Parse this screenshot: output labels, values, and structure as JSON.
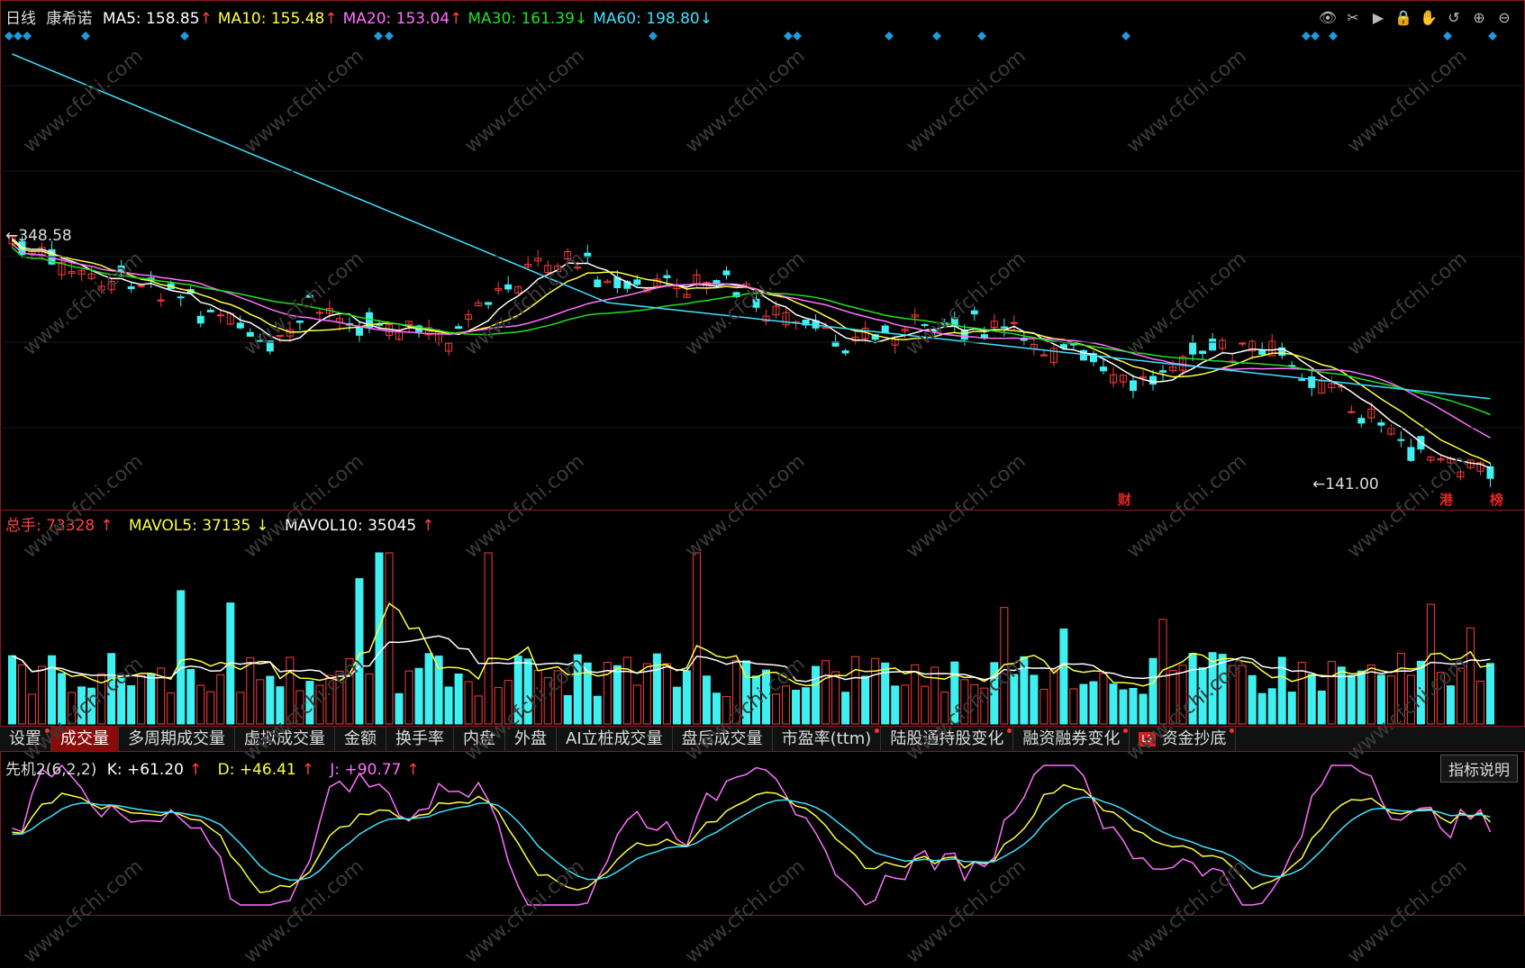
{
  "main": {
    "period": "日线",
    "stock_name": "康希诺",
    "ma": [
      {
        "label": "MA5: 158.85",
        "arrow": "↑",
        "color": "#ffffff"
      },
      {
        "label": "MA10: 155.48",
        "arrow": "↑",
        "color": "#ffff40"
      },
      {
        "label": "MA20: 153.04",
        "arrow": "↑",
        "color": "#ff70ff"
      },
      {
        "label": "MA30: 161.39",
        "arrow": "↓",
        "color": "#20e020"
      },
      {
        "label": "MA60: 198.80",
        "arrow": "↓",
        "color": "#40e0ff"
      }
    ],
    "high_label": "348.58",
    "low_label": "141.00",
    "events": [
      "财",
      "港",
      "榜"
    ]
  },
  "volume": {
    "total_label": "总手: 73328",
    "total_arrow": "↑",
    "mavol5_label": "MAVOL5: 37135",
    "mavol5_arrow": "↓",
    "mavol10_label": "MAVOL10: 35045",
    "mavol10_arrow": "↑"
  },
  "tabs": [
    {
      "label": "设置",
      "dot": true,
      "active": false
    },
    {
      "label": "成交量",
      "dot": false,
      "active": true
    },
    {
      "label": "多周期成交量",
      "dot": false,
      "active": false
    },
    {
      "label": "虚拟成交量",
      "dot": false,
      "active": false
    },
    {
      "label": "金额",
      "dot": false,
      "active": false
    },
    {
      "label": "换手率",
      "dot": false,
      "active": false
    },
    {
      "label": "内盘",
      "dot": false,
      "active": false
    },
    {
      "label": "外盘",
      "dot": false,
      "active": false
    },
    {
      "label": "AI立桩成交量",
      "dot": false,
      "active": false
    },
    {
      "label": "盘后成交量",
      "dot": false,
      "active": false
    },
    {
      "label": "市盈率(ttm)",
      "dot": true,
      "active": false
    },
    {
      "label": "陆股通持股变化",
      "dot": true,
      "active": false
    },
    {
      "label": "融资融券变化",
      "dot": true,
      "active": false
    },
    {
      "label": "资金抄底",
      "dot": true,
      "active": false,
      "badge": "L2"
    }
  ],
  "kdj": {
    "name": "先机2(6,2,2)",
    "k_label": "K: +61.20",
    "k_arrow": "↑",
    "d_label": "D: +46.41",
    "d_arrow": "↑",
    "j_label": "J: +90.77",
    "j_arrow": "↑",
    "desc_button": "指标说明"
  },
  "watermark": "www.cfchi.com",
  "colors": {
    "up": "#ff3b3b",
    "down": "#40f0f0",
    "frame": "#8a1a1a",
    "diamond": "#1e9be0"
  },
  "chart_data": {
    "type": "candlestick",
    "price_range": [
      141.0,
      348.58
    ]
  }
}
